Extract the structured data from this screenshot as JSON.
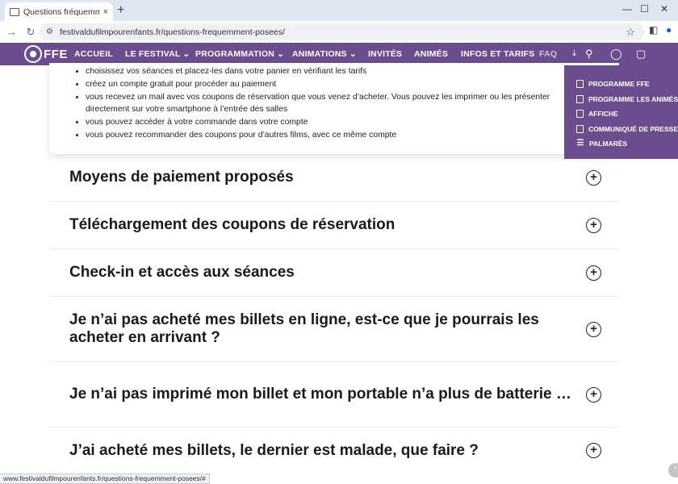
{
  "browser": {
    "tab_title": "Questions fréquemment posé",
    "tab_close": "×",
    "new_tab": "+",
    "url": "festivaldufilmpourenfants.fr/questions-frequemment-posees/",
    "status_url": "www.festivaldufilmpourenfants.fr/questions-frequemment-posees/#"
  },
  "site": {
    "logo_text": "FFE",
    "nav": [
      {
        "label": "ACCUEIL"
      },
      {
        "label": "LE FESTIVAL ⌄"
      },
      {
        "label": "PROGRAMMATION ⌄"
      },
      {
        "label": "ANIMATIONS ⌄"
      },
      {
        "label": "INVITÉS"
      },
      {
        "label": "ANIMÉS"
      },
      {
        "label": "INFOS ET TARIFS"
      },
      {
        "label": "FAQ"
      }
    ],
    "downloads": [
      {
        "label": "PROGRAMME FFE",
        "icon": "pdf-icon"
      },
      {
        "label": "PROGRAMME LES ANIMÉS",
        "icon": "pdf-icon"
      },
      {
        "label": "AFFICHE",
        "icon": "pdf-icon"
      },
      {
        "label": "COMMUNIQUÉ DE PRESSE",
        "icon": "document-icon"
      },
      {
        "label": "PALMARÈS",
        "icon": "list-icon"
      }
    ]
  },
  "card_items": [
    "choisissez vos séances et placez-les dans votre panier en vérifiant les tarifs",
    "créez un compte gratuit pour procéder au paiement",
    "vous recevez un mail avec vos coupons de réservation que vous venez d’acheter. Vous pouvez les imprimer ou les présenter directement sur votre smartphone à l’entrée des salles",
    "vous pouvez accéder à votre commande dans votre compte",
    "vous pouvez recommander des coupons pour d’autres films, avec ce même compte"
  ],
  "faq": [
    {
      "title": "Moyens de paiement proposés"
    },
    {
      "title": "Téléchargement des coupons de réservation"
    },
    {
      "title": "Check-in et accès aux séances"
    },
    {
      "title": "Je n’ai pas acheté mes billets en ligne, est-ce que je pourrais les acheter en arrivant ?"
    },
    {
      "title": "Je n’ai pas imprimé mon billet et mon portable n’a plus de batterie …"
    },
    {
      "title": "J’ai acheté mes billets, le dernier est malade, que faire ?"
    }
  ]
}
